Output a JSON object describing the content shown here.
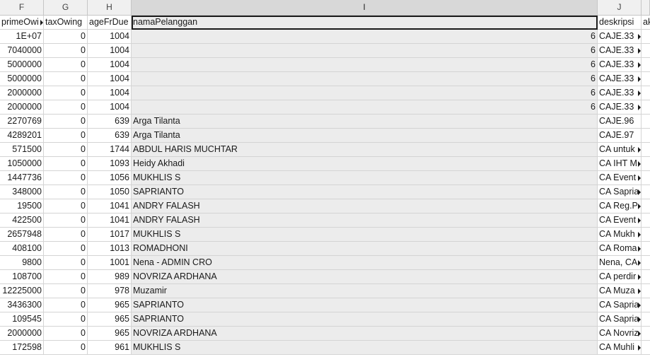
{
  "column_letters": [
    "F",
    "G",
    "H",
    "I",
    "J",
    ""
  ],
  "header_row": [
    "primeOwi",
    "taxOwing",
    "ageFrDue",
    "namaPelanggan",
    "deskripsi",
    "ak"
  ],
  "rows": [
    [
      "1E+07",
      "0",
      "1004",
      "6",
      "CAJE.33"
    ],
    [
      "7040000",
      "0",
      "1004",
      "6",
      "CAJE.33"
    ],
    [
      "5000000",
      "0",
      "1004",
      "6",
      "CAJE.33"
    ],
    [
      "5000000",
      "0",
      "1004",
      "6",
      "CAJE.33"
    ],
    [
      "2000000",
      "0",
      "1004",
      "6",
      "CAJE.33"
    ],
    [
      "2000000",
      "0",
      "1004",
      "6",
      "CAJE.33"
    ],
    [
      "2270769",
      "0",
      "639",
      "Arga Tilanta",
      "CAJE.96"
    ],
    [
      "4289201",
      "0",
      "639",
      "Arga Tilanta",
      "CAJE.97"
    ],
    [
      "571500",
      "0",
      "1744",
      "ABDUL HARIS MUCHTAR",
      "CA untuk"
    ],
    [
      "1050000",
      "0",
      "1093",
      "Heidy Akhadi",
      "CA IHT M"
    ],
    [
      "1447736",
      "0",
      "1056",
      "MUKHLIS S",
      "CA Event"
    ],
    [
      "348000",
      "0",
      "1050",
      "SAPRIANTO",
      "CA Sapria"
    ],
    [
      "19500",
      "0",
      "1041",
      "ANDRY FALASH",
      "CA Reg.P"
    ],
    [
      "422500",
      "0",
      "1041",
      "ANDRY FALASH",
      "CA Event"
    ],
    [
      "2657948",
      "0",
      "1017",
      "MUKHLIS S",
      "CA Mukh"
    ],
    [
      "408100",
      "0",
      "1013",
      "ROMADHONI",
      "CA Roma"
    ],
    [
      "9800",
      "0",
      "1001",
      "Nena - ADMIN CRO",
      "Nena, CA"
    ],
    [
      "108700",
      "0",
      "989",
      "NOVRIZA ARDHANA",
      "CA perdir"
    ],
    [
      "12225000",
      "0",
      "978",
      "Muzamir",
      "CA Muza"
    ],
    [
      "3436300",
      "0",
      "965",
      "SAPRIANTO",
      "CA Sapria"
    ],
    [
      "109545",
      "0",
      "965",
      "SAPRIANTO",
      "CA Sapria"
    ],
    [
      "2000000",
      "0",
      "965",
      "NOVRIZA ARDHANA",
      "CA Novriz"
    ],
    [
      "172598",
      "0",
      "961",
      "MUKHLIS S",
      "CA Muhli"
    ]
  ],
  "arrow_rows_j": [
    0,
    1,
    2,
    3,
    4,
    5,
    8,
    9,
    10,
    11,
    12,
    13,
    14,
    15,
    16,
    17,
    18,
    19,
    20,
    21,
    22
  ],
  "colors": {
    "header_bg": "#f0f0f0",
    "selected_header_bg": "#d8d8d8",
    "column_i_bg": "#ececec",
    "grid_line": "#d4d4d4"
  }
}
